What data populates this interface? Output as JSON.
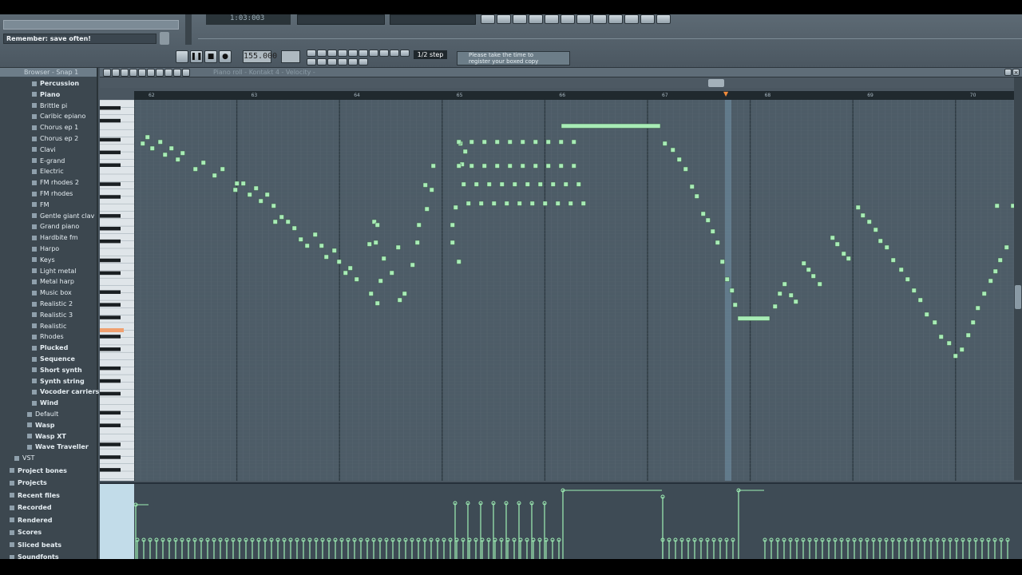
{
  "hint": {
    "text": "Remember: save often!"
  },
  "lcd": {
    "time": "1:03:003"
  },
  "transport": {
    "tempo": "155.000",
    "snap": "1/2 step"
  },
  "tip": {
    "line1": "Please take the time to",
    "line2": "register your boxed copy"
  },
  "piano_roll": {
    "title": "Piano roll - Kontakt 4 - Velocity -"
  },
  "browser": {
    "title": "Browser - Snap 1",
    "items": [
      {
        "label": "Percussion",
        "level": 3,
        "folder": true
      },
      {
        "label": "Piano",
        "level": 3,
        "folder": true
      },
      {
        "label": "Brittle pi",
        "level": 4,
        "folder": false
      },
      {
        "label": "Caribic epiano",
        "level": 4,
        "folder": false
      },
      {
        "label": "Chorus ep 1",
        "level": 4,
        "folder": false
      },
      {
        "label": "Chorus ep 2",
        "level": 4,
        "folder": false
      },
      {
        "label": "Clavi",
        "level": 4,
        "folder": false
      },
      {
        "label": "E-grand",
        "level": 4,
        "folder": false
      },
      {
        "label": "Electric",
        "level": 4,
        "folder": false
      },
      {
        "label": "FM rhodes 2",
        "level": 4,
        "folder": false
      },
      {
        "label": "FM rhodes",
        "level": 4,
        "folder": false
      },
      {
        "label": "FM",
        "level": 4,
        "folder": false
      },
      {
        "label": "Gentle giant clav",
        "level": 4,
        "folder": false
      },
      {
        "label": "Grand piano",
        "level": 4,
        "folder": false
      },
      {
        "label": "Hardbite fm",
        "level": 4,
        "folder": false
      },
      {
        "label": "Harpo",
        "level": 4,
        "folder": false
      },
      {
        "label": "Keys",
        "level": 4,
        "folder": false
      },
      {
        "label": "Light metal",
        "level": 4,
        "folder": false
      },
      {
        "label": "Metal harp",
        "level": 4,
        "folder": false
      },
      {
        "label": "Music box",
        "level": 4,
        "folder": false
      },
      {
        "label": "Realistic 2",
        "level": 4,
        "folder": false
      },
      {
        "label": "Realistic 3",
        "level": 4,
        "folder": false
      },
      {
        "label": "Realistic",
        "level": 4,
        "folder": false
      },
      {
        "label": "Rhodes",
        "level": 4,
        "folder": false
      },
      {
        "label": "Plucked",
        "level": 3,
        "folder": true
      },
      {
        "label": "Sequence",
        "level": 3,
        "folder": true
      },
      {
        "label": "Short synth",
        "level": 3,
        "folder": true
      },
      {
        "label": "Synth string",
        "level": 3,
        "folder": true
      },
      {
        "label": "Vocoder carriers",
        "level": 3,
        "folder": true
      },
      {
        "label": "Wind",
        "level": 3,
        "folder": true
      },
      {
        "label": "Default",
        "level": 2,
        "folder": false
      },
      {
        "label": "Wasp",
        "level": 2,
        "folder": true
      },
      {
        "label": "Wasp XT",
        "level": 2,
        "folder": true
      },
      {
        "label": "Wave Traveller",
        "level": 2,
        "folder": true
      },
      {
        "label": "VST",
        "level": 1,
        "folder": false
      },
      {
        "label": "Project bones",
        "level": 0,
        "folder": true
      },
      {
        "label": "Projects",
        "level": 0,
        "folder": true
      },
      {
        "label": "Recent files",
        "level": 0,
        "folder": true
      },
      {
        "label": "Recorded",
        "level": 0,
        "folder": true
      },
      {
        "label": "Rendered",
        "level": 0,
        "folder": true
      },
      {
        "label": "Scores",
        "level": 0,
        "folder": true
      },
      {
        "label": "Sliced beats",
        "level": 0,
        "folder": true
      },
      {
        "label": "Soundfonts",
        "level": 0,
        "folder": true
      }
    ]
  },
  "ruler": {
    "bars": [
      "62",
      "63",
      "64",
      "65",
      "66",
      "67",
      "68",
      "69",
      "70"
    ]
  },
  "colors": {
    "note": "#a8ecb6",
    "grid_bg": "#4d5c67",
    "velocity": "#9ff0b5"
  }
}
